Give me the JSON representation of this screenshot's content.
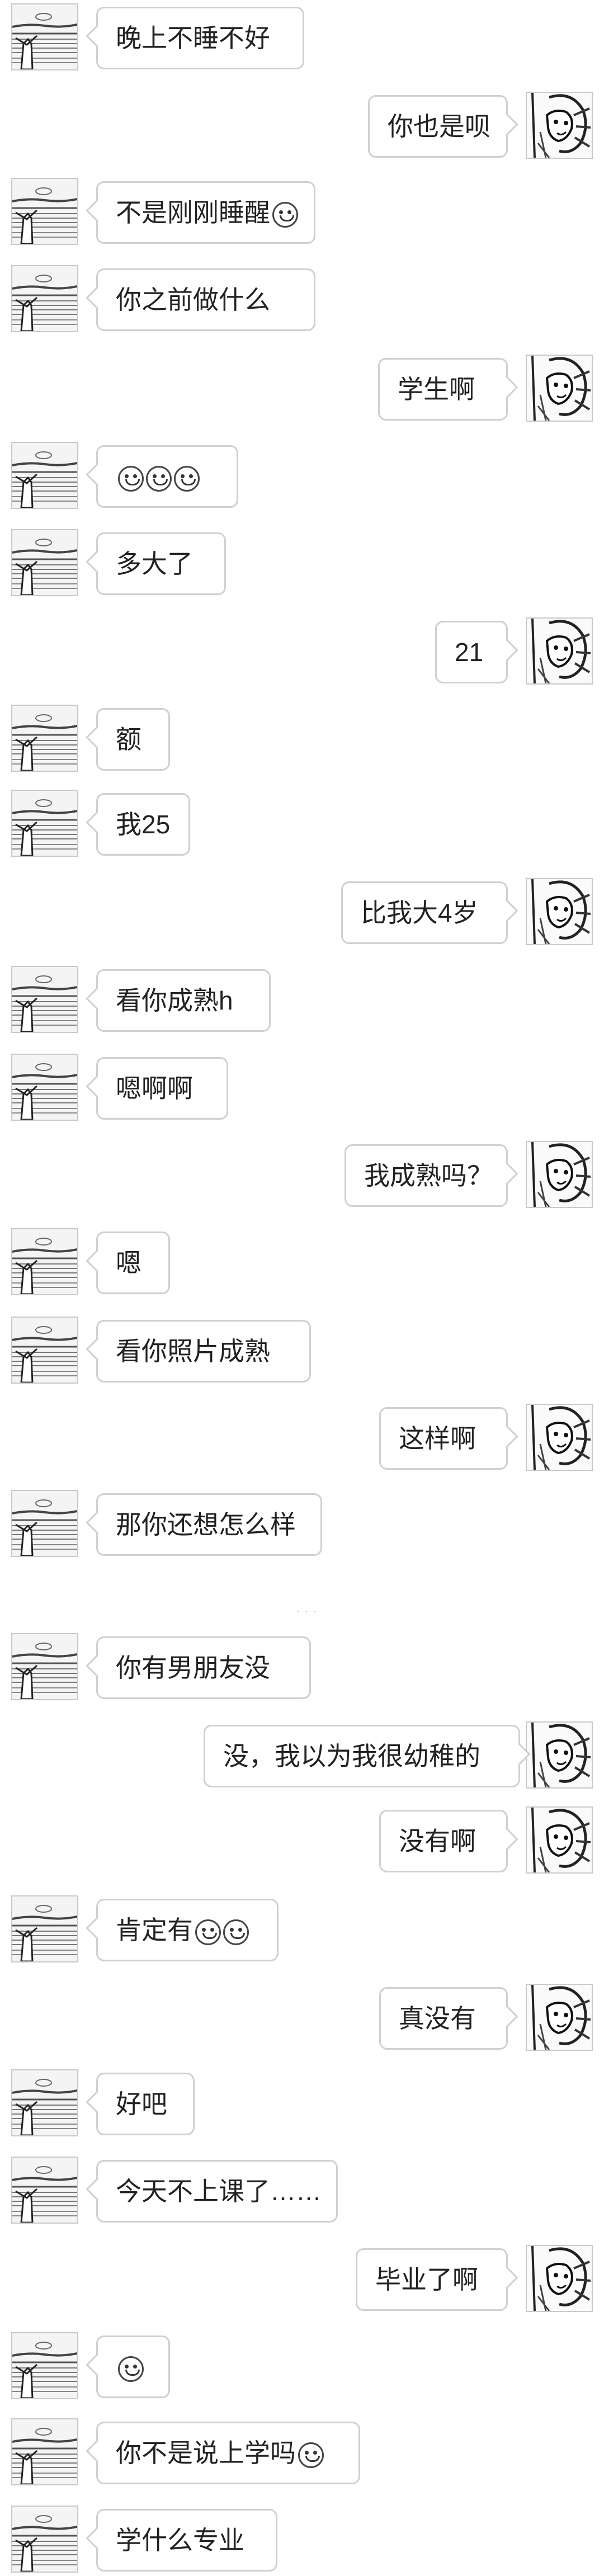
{
  "avatars": {
    "left": "landscape-avatar",
    "right": "sketch-portrait-avatar"
  },
  "messages": [
    {
      "side": "left",
      "text": "晚上不睡不好",
      "emoji": 0
    },
    {
      "side": "right",
      "text": "你也是呗",
      "emoji": 0
    },
    {
      "side": "left",
      "text": "不是刚刚睡醒",
      "emoji": 1
    },
    {
      "side": "left",
      "text": "你之前做什么",
      "emoji": 0
    },
    {
      "side": "right",
      "text": "学生啊",
      "emoji": 0
    },
    {
      "side": "left",
      "text": "",
      "emoji": 3
    },
    {
      "side": "left",
      "text": "多大了",
      "emoji": 0
    },
    {
      "side": "right",
      "text": "21",
      "emoji": 0
    },
    {
      "side": "left",
      "text": "额",
      "emoji": 0
    },
    {
      "side": "left",
      "text": "我25",
      "emoji": 0
    },
    {
      "side": "right",
      "text": "比我大4岁",
      "emoji": 0
    },
    {
      "side": "left",
      "text": "看你成熟h",
      "emoji": 0
    },
    {
      "side": "left",
      "text": "嗯啊啊",
      "emoji": 0
    },
    {
      "side": "right",
      "text": "我成熟吗？",
      "emoji": 0
    },
    {
      "side": "left",
      "text": "嗯",
      "emoji": 0
    },
    {
      "side": "left",
      "text": "看你照片成熟",
      "emoji": 0
    },
    {
      "side": "right",
      "text": "这样啊",
      "emoji": 0
    },
    {
      "side": "left",
      "text": "那你还想怎么样",
      "emoji": 0
    },
    {
      "side": "left",
      "text": "你有男朋友没",
      "emoji": 0
    },
    {
      "side": "right",
      "text": "没，我以为我很幼稚的",
      "emoji": 0
    },
    {
      "side": "right",
      "text": "没有啊",
      "emoji": 0
    },
    {
      "side": "left",
      "text": "肯定有",
      "emoji": 2
    },
    {
      "side": "right",
      "text": "真没有",
      "emoji": 0
    },
    {
      "side": "left",
      "text": "好吧",
      "emoji": 0
    },
    {
      "side": "left",
      "text": "今天不上课了……",
      "emoji": 0
    },
    {
      "side": "right",
      "text": "毕业了啊",
      "emoji": 0
    },
    {
      "side": "left",
      "text": "",
      "emoji": 1
    },
    {
      "side": "left",
      "text": "你不是说上学吗",
      "emoji": 1
    },
    {
      "side": "left",
      "text": "学什么专业",
      "emoji": 0
    }
  ]
}
